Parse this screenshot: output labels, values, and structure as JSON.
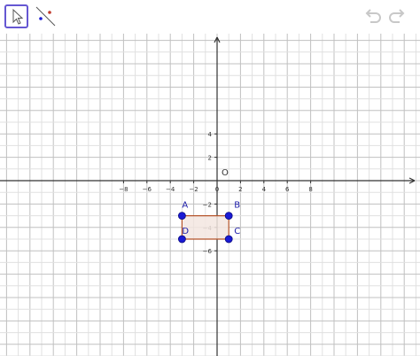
{
  "toolbar": {
    "tools": [
      {
        "name": "move-tool",
        "icon": "cursor-arrow-icon",
        "selected": true
      },
      {
        "name": "point-on-object-tool",
        "icon": "point-line-icon",
        "selected": false
      }
    ],
    "undo_icon": "undo-icon",
    "redo_icon": "redo-icon",
    "accent_color": "#6557d2"
  },
  "graphics": {
    "x_ticks": [
      "−8",
      "−6",
      "−4",
      "−2",
      "0",
      "2",
      "4",
      "6",
      "8"
    ],
    "x_tick_values": [
      -8,
      -6,
      -4,
      -2,
      0,
      2,
      4,
      6,
      8
    ],
    "y_ticks": [
      "4",
      "2",
      "−2",
      "−4",
      "−6"
    ],
    "y_tick_values": [
      4,
      2,
      -2,
      -4,
      -6
    ],
    "origin_label": "O",
    "grid": true,
    "axis_color": "#333333",
    "grid_color": "#e0e0e0",
    "grid_major_color": "#c0c0c0",
    "point_color": "#1a1ad4",
    "polygon_stroke": "#b5552b",
    "polygon_fill": "#f3e6e1",
    "points": [
      {
        "label": "A",
        "x": -3,
        "y": -3
      },
      {
        "label": "B",
        "x": 1,
        "y": -3
      },
      {
        "label": "C",
        "x": 1,
        "y": -5
      },
      {
        "label": "D",
        "x": -3,
        "y": -5
      }
    ],
    "polygon": [
      "A",
      "B",
      "C",
      "D"
    ]
  }
}
